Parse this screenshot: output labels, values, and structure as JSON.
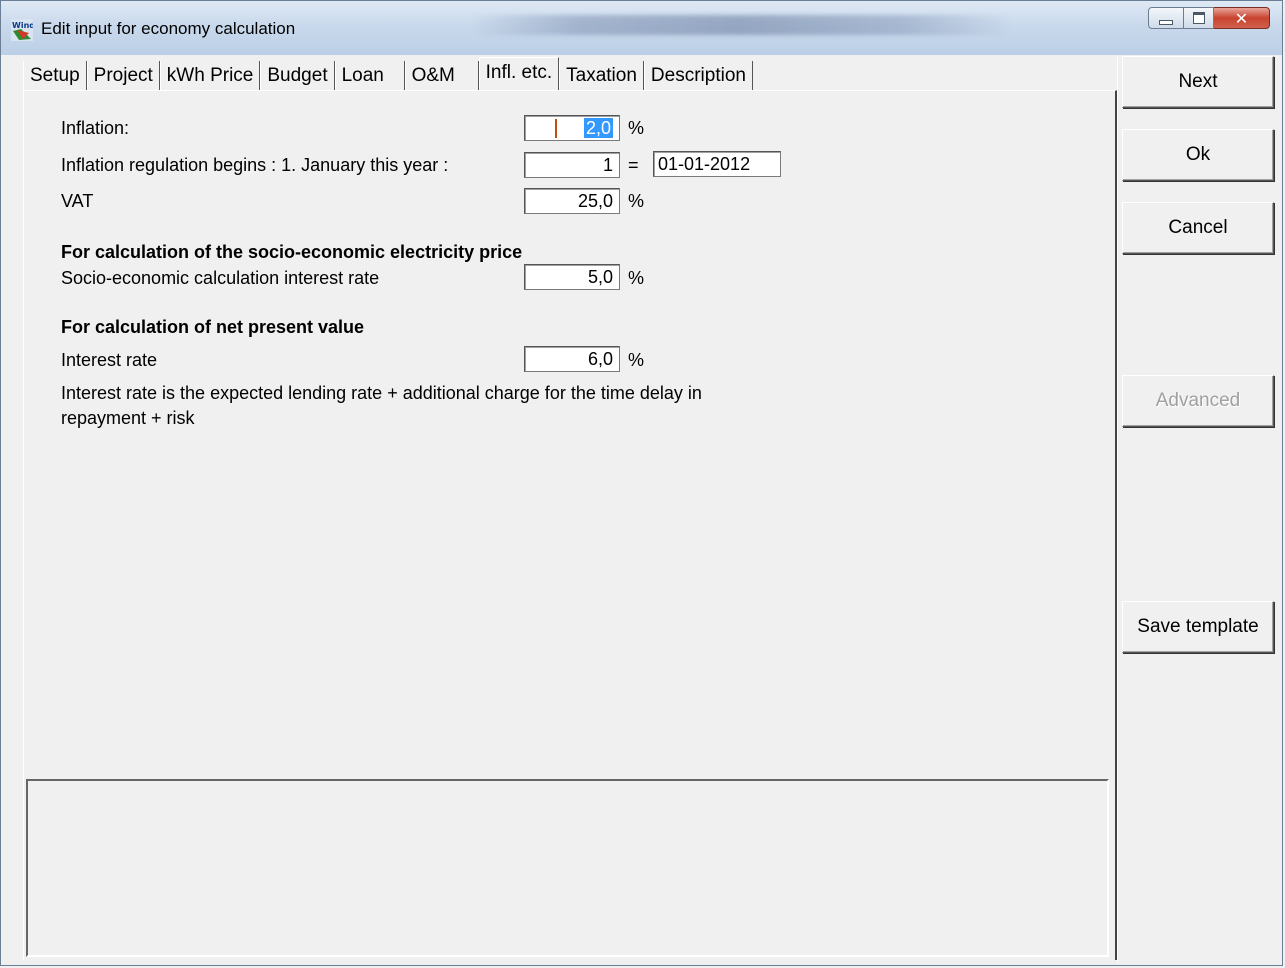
{
  "window": {
    "title": "Edit input for economy calculation",
    "app_icon": "windpro-logo-icon"
  },
  "tabs": [
    {
      "label": "Setup",
      "active": false
    },
    {
      "label": "Project",
      "active": false
    },
    {
      "label": "kWh Price",
      "active": false
    },
    {
      "label": "Budget",
      "active": false
    },
    {
      "label": "Loan",
      "active": false
    },
    {
      "label": "O&M",
      "active": false
    },
    {
      "label": "Infl. etc.",
      "active": true
    },
    {
      "label": "Taxation",
      "active": false
    },
    {
      "label": "Description",
      "active": false
    }
  ],
  "form": {
    "inflation_label": "Inflation:",
    "inflation_value": "2,0",
    "inflation_unit": "%",
    "regulation_label": "Inflation regulation begins : 1. January this year :",
    "regulation_value": "1",
    "regulation_equals": "=",
    "regulation_date": "01-01-2012",
    "vat_label": "VAT",
    "vat_value": "25,0",
    "vat_unit": "%",
    "socio_heading": "For calculation of the socio-economic electricity price",
    "socio_label": "Socio-economic calculation interest rate",
    "socio_value": "5,0",
    "socio_unit": "%",
    "npv_heading": "For calculation of net present value",
    "interest_label": "Interest rate",
    "interest_value": "6,0",
    "interest_unit": "%",
    "interest_note_line1": "Interest rate is the expected lending rate + additional charge for the time delay in",
    "interest_note_line2": "repayment + risk"
  },
  "buttons": {
    "next": "Next",
    "ok": "Ok",
    "cancel": "Cancel",
    "advanced": "Advanced",
    "save_template": "Save template"
  }
}
